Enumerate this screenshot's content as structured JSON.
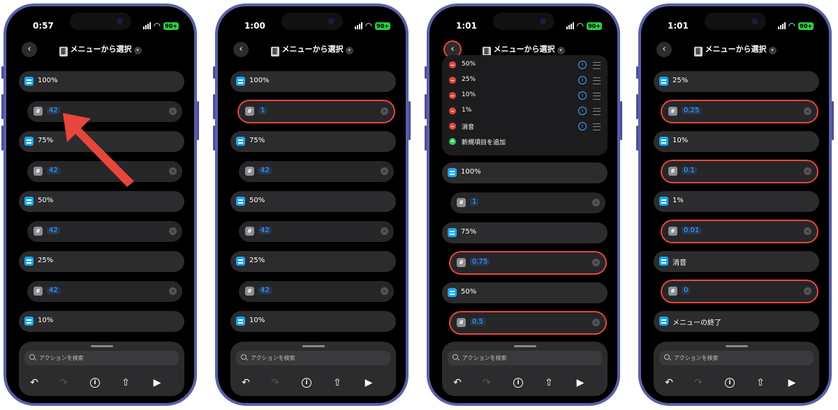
{
  "common": {
    "nav_title": "メニューから選択",
    "search_placeholder": "アクションを検索",
    "battery": "90+"
  },
  "phones": [
    {
      "time": "0:57",
      "rows": [
        {
          "kind": "menu",
          "label": "100%"
        },
        {
          "kind": "num",
          "value": "42",
          "hl": false
        },
        {
          "kind": "menu",
          "label": "75%"
        },
        {
          "kind": "num",
          "value": "42",
          "hl": false
        },
        {
          "kind": "menu",
          "label": "50%"
        },
        {
          "kind": "num",
          "value": "42",
          "hl": false
        },
        {
          "kind": "menu",
          "label": "25%"
        },
        {
          "kind": "num",
          "value": "42",
          "hl": false
        },
        {
          "kind": "menu",
          "label": "10%"
        }
      ]
    },
    {
      "time": "1:00",
      "rows": [
        {
          "kind": "menu",
          "label": "100%"
        },
        {
          "kind": "num",
          "value": "1",
          "hl": true
        },
        {
          "kind": "menu",
          "label": "75%"
        },
        {
          "kind": "num",
          "value": "42",
          "hl": false
        },
        {
          "kind": "menu",
          "label": "50%"
        },
        {
          "kind": "num",
          "value": "42",
          "hl": false
        },
        {
          "kind": "menu",
          "label": "25%"
        },
        {
          "kind": "num",
          "value": "42",
          "hl": false
        },
        {
          "kind": "menu",
          "label": "10%"
        }
      ]
    },
    {
      "time": "1:01",
      "list_items": [
        "50%",
        "25%",
        "10%",
        "1%",
        "消音"
      ],
      "add_item": "新規項目を追加",
      "rows": [
        {
          "kind": "menu",
          "label": "100%"
        },
        {
          "kind": "num",
          "value": "1",
          "hl": false
        },
        {
          "kind": "menu",
          "label": "75%"
        },
        {
          "kind": "num",
          "value": "0.75",
          "hl": true
        },
        {
          "kind": "menu",
          "label": "50%"
        },
        {
          "kind": "num",
          "value": "0.5",
          "hl": true
        }
      ]
    },
    {
      "time": "1:01",
      "rows": [
        {
          "kind": "menu",
          "label": "25%"
        },
        {
          "kind": "num",
          "value": "0.25",
          "hl": true
        },
        {
          "kind": "menu",
          "label": "10%"
        },
        {
          "kind": "num",
          "value": "0.1",
          "hl": true
        },
        {
          "kind": "menu",
          "label": "1%"
        },
        {
          "kind": "num",
          "value": "0.01",
          "hl": true
        },
        {
          "kind": "menu",
          "label": "消音"
        },
        {
          "kind": "num",
          "value": "0",
          "hl": true
        },
        {
          "kind": "menu",
          "label": "メニューの終了"
        }
      ]
    }
  ],
  "colors": {
    "highlight": "#e8463c",
    "accent": "#1aa8f0",
    "value": "#4aa3ff"
  },
  "icons": [
    "back-chevron-icon",
    "calculator-icon",
    "menu-icon",
    "number-icon",
    "clear-icon",
    "search-icon",
    "undo-icon",
    "redo-icon",
    "info-icon",
    "share-icon",
    "play-icon",
    "remove-icon",
    "add-icon",
    "drag-handle-icon"
  ]
}
